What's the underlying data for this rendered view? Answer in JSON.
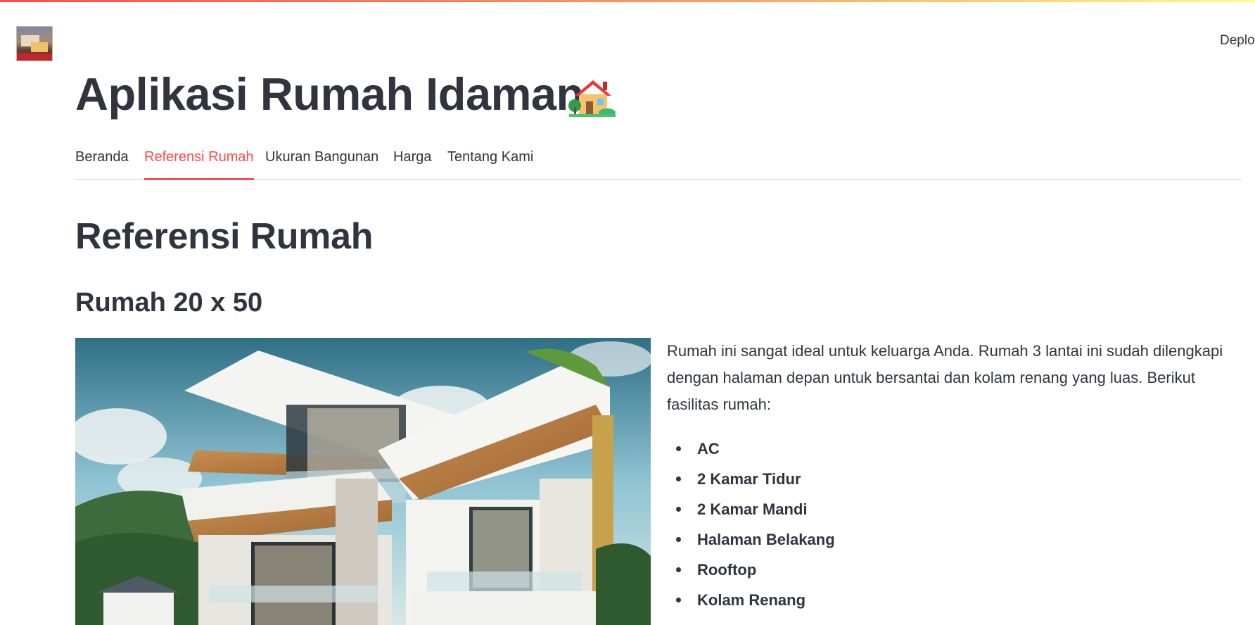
{
  "header": {
    "logo_name": "house-logo",
    "deploy_label": "Deplo"
  },
  "app": {
    "title": "Aplikasi Rumah Idaman",
    "title_emoji": "house-with-garden-icon"
  },
  "tabs": [
    {
      "label": "Beranda",
      "active": false
    },
    {
      "label": "Referensi Rumah",
      "active": true
    },
    {
      "label": "Ukuran Bangunan",
      "active": false
    },
    {
      "label": "Harga",
      "active": false
    },
    {
      "label": "Tentang Kami",
      "active": false
    }
  ],
  "content": {
    "section_title": "Referensi Rumah",
    "house": {
      "title": "Rumah 20 x 50",
      "description": "Rumah ini sangat ideal untuk keluarga Anda. Rumah 3 lantai ini sudah dilengkapi dengan halaman depan untuk bersantai dan kolam renang yang luas. Berikut fasilitas rumah:",
      "facilities": [
        "AC",
        "2 Kamar Tidur",
        "2 Kamar Mandi",
        "Halaman Belakang",
        "Rooftop",
        "Kolam Renang"
      ]
    }
  },
  "colors": {
    "accent": "#ff4b4b",
    "text": "#31333f",
    "divider": "#e6e6ea"
  }
}
